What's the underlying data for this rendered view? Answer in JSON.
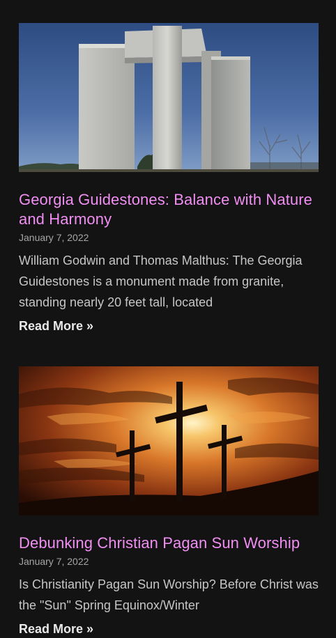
{
  "posts": [
    {
      "image_alt": "Georgia Guidestones monument",
      "title": "Georgia Guidestones: Balance with Nature and Harmony",
      "date": "January 7, 2022",
      "excerpt": "William Godwin and Thomas Malthus: The Georgia Guidestones is a monument made from granite, standing nearly 20 feet tall, located",
      "read_more": "Read More »"
    },
    {
      "image_alt": "Three crosses silhouetted against a sunset",
      "title": "Debunking Christian Pagan Sun Worship",
      "date": "January 7, 2022",
      "excerpt": "Is Christianity Pagan Sun Worship? Before Christ was the \"Sun\" Spring Equinox/Winter",
      "read_more": "Read More »"
    }
  ],
  "colors": {
    "background": "#131314",
    "title": "#f08ef2",
    "date": "#a6a6a6",
    "excerpt": "#c6c6c6",
    "read_more": "#e9e9e9"
  }
}
